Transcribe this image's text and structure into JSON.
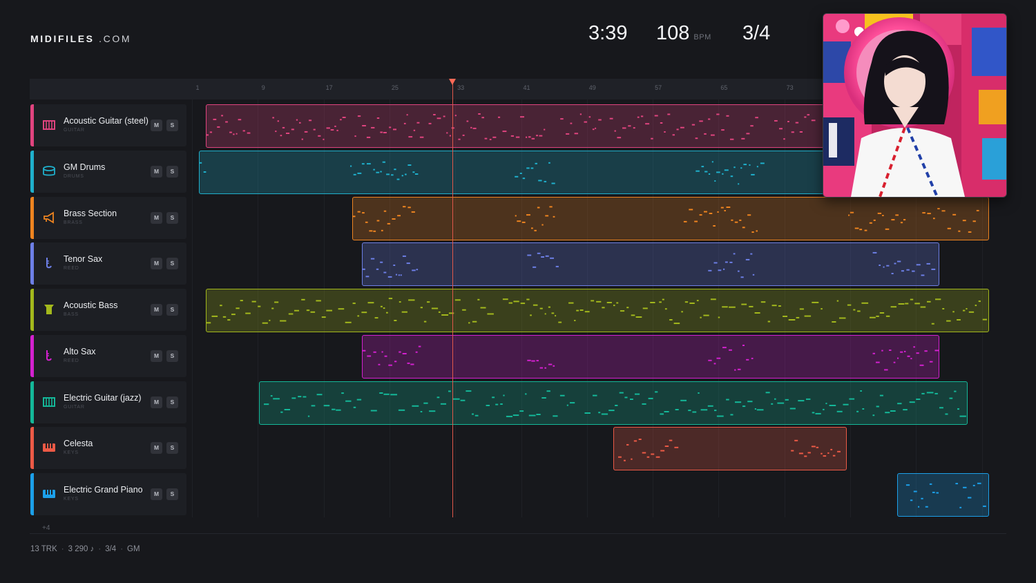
{
  "header": {
    "logo_bold": "MIDIFILES",
    "logo_suffix": ".COM",
    "time": "3:39",
    "bpm": "108",
    "bpm_unit": "BPM",
    "time_signature": "3/4"
  },
  "ruler": {
    "ticks": [
      "1",
      "9",
      "17",
      "25",
      "33",
      "41",
      "49",
      "57",
      "65",
      "73"
    ]
  },
  "playhead": {
    "bar": 33
  },
  "tracks": [
    {
      "name": "Acoustic Guitar (steel)",
      "category": "GUITAR",
      "icon": "guitar-icon",
      "color": "#e0447f",
      "mute": "M",
      "solo": "S"
    },
    {
      "name": "GM Drums",
      "category": "DRUMS",
      "icon": "drum-icon",
      "color": "#1fb0cc",
      "mute": "M",
      "solo": "S"
    },
    {
      "name": "Brass Section",
      "category": "BRASS",
      "icon": "horn-icon",
      "color": "#ee8420",
      "mute": "M",
      "solo": "S"
    },
    {
      "name": "Tenor Sax",
      "category": "REED",
      "icon": "sax-icon",
      "color": "#6d7fe6",
      "mute": "M",
      "solo": "S"
    },
    {
      "name": "Acoustic Bass",
      "category": "BASS",
      "icon": "bass-icon",
      "color": "#a3b81c",
      "mute": "M",
      "solo": "S"
    },
    {
      "name": "Alto Sax",
      "category": "REED",
      "icon": "sax-icon",
      "color": "#d321cf",
      "mute": "M",
      "solo": "S"
    },
    {
      "name": "Electric Guitar (jazz)",
      "category": "GUITAR",
      "icon": "guitar-icon",
      "color": "#14b899",
      "mute": "M",
      "solo": "S"
    },
    {
      "name": "Celesta",
      "category": "KEYS",
      "icon": "keys-icon",
      "color": "#ec5a46",
      "mute": "M",
      "solo": "S"
    },
    {
      "name": "Electric Grand Piano",
      "category": "KEYS",
      "icon": "keys-icon",
      "color": "#1ca0ea",
      "mute": "M",
      "solo": "S"
    }
  ],
  "more_tracks": "+4",
  "footer": {
    "tracks": "13 TRK",
    "notes": "3 290 ♪",
    "time_signature": "3/4",
    "standard": "GM"
  }
}
